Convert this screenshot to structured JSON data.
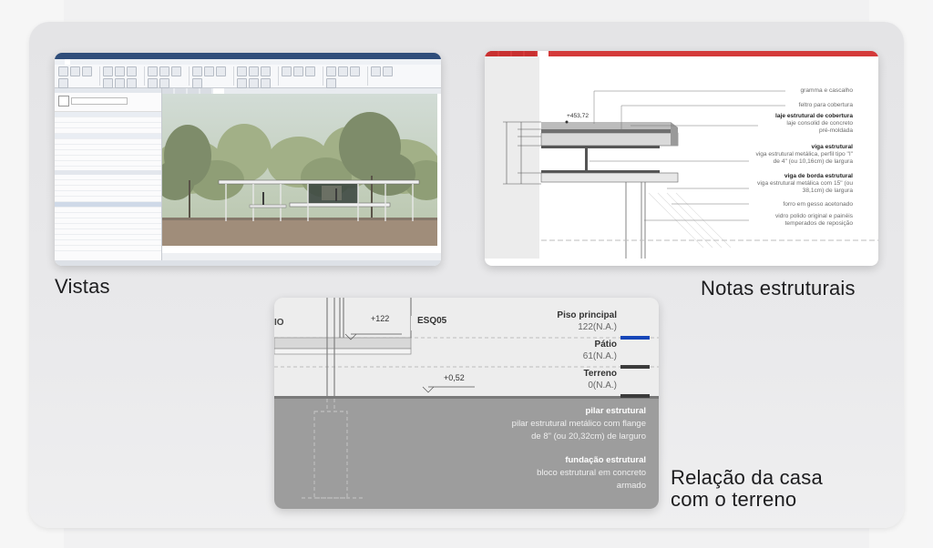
{
  "captions": {
    "vistas": "Vistas",
    "notas": "Notas estruturais",
    "relacao_line1": "Relação da casa",
    "relacao_line2": "com o terreno"
  },
  "cad_notes": [
    {
      "title": "",
      "lines": [
        "gramma e cascalho"
      ]
    },
    {
      "title": "",
      "lines": [
        "feltro para cobertura"
      ]
    },
    {
      "title": "laje estrutural de cobertura",
      "lines": [
        "laje consolid de concreto",
        "pré-moldada"
      ]
    },
    {
      "title": "viga estrutural",
      "lines": [
        "viga estrutural metálica, perfil tipo \"I\"",
        "de 4\" (ou 10,16cm) de largura"
      ]
    },
    {
      "title": "viga de borda estrutural",
      "lines": [
        "viga estrutural metálica com 15\" (ou",
        "38,1cm) de largura"
      ]
    },
    {
      "title": "",
      "lines": [
        "forro em gesso acetonado"
      ]
    },
    {
      "title": "",
      "lines": [
        "vidro polido original e painéis",
        "temperados de reposição"
      ]
    }
  ],
  "cad_level": "+453,72",
  "terreno": {
    "left_label": "IO",
    "marker_122": "+122",
    "tag": "ESQ05",
    "marker_052": "+0,52",
    "levels": [
      {
        "name": "Piso principal",
        "value": "122(N.A.)",
        "color": "#1646b8"
      },
      {
        "name": "Pátio",
        "value": "61(N.A.)",
        "color": "#3b3b3b"
      },
      {
        "name": "Terreno",
        "value": "0(N.A.)",
        "color": "#3b3b3b"
      }
    ],
    "notes": [
      {
        "title": "pilar estrutural",
        "lines": [
          "pilar estrutural metálico com flange",
          "de 8\" (ou 20,32cm) de larguro"
        ]
      },
      {
        "title": "fundação estrutural",
        "lines": [
          "bloco estrutural em concreto",
          "armado"
        ]
      }
    ]
  }
}
